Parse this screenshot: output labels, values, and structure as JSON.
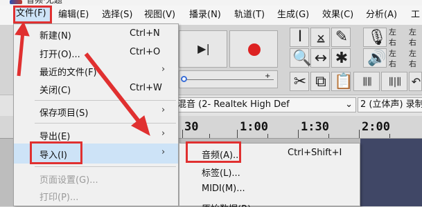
{
  "window": {
    "title": "音频·无题"
  },
  "menubar": {
    "items": [
      {
        "label": "文件(F)"
      },
      {
        "label": "编辑(E)"
      },
      {
        "label": "选择(S)"
      },
      {
        "label": "视图(V)"
      },
      {
        "label": "播录(N)"
      },
      {
        "label": "轨道(T)"
      },
      {
        "label": "生成(G)"
      },
      {
        "label": "效果(C)"
      },
      {
        "label": "分析(A)"
      },
      {
        "label": "工"
      }
    ]
  },
  "file_menu": {
    "items": [
      {
        "label": "新建(N)",
        "shortcut": "Ctrl+N"
      },
      {
        "label": "打开(O)...",
        "shortcut": "Ctrl+O"
      },
      {
        "label": "最近的文件(F)",
        "arrow": "›"
      },
      {
        "label": "关闭(C)",
        "shortcut": "Ctrl+W"
      },
      {
        "label": "保存项目(S)",
        "arrow": "›"
      },
      {
        "label": "导出(E)",
        "arrow": "›"
      },
      {
        "label": "导入(I)",
        "arrow": "›"
      },
      {
        "label": "页面设置(G)..."
      },
      {
        "label": "打印(P)..."
      }
    ]
  },
  "import_submenu": {
    "items": [
      {
        "label": "音频(A)...",
        "shortcut": "Ctrl+Shift+I"
      },
      {
        "label": "标签(L)..."
      },
      {
        "label": "MIDI(M)..."
      },
      {
        "label": "原始数据(R)..."
      }
    ]
  },
  "toolbar": {
    "meter_labels": [
      "左",
      "右",
      "左",
      "右",
      "左",
      "右",
      "左",
      "右"
    ]
  },
  "device_row": {
    "input_device": "混音 (2- Realtek High Def",
    "channels": "2 (立体声) 录制"
  },
  "timeline": {
    "labels": [
      "30",
      "1:00",
      "1:30",
      "2:00"
    ]
  },
  "colors": {
    "annotation": "#e03030",
    "menu_highlight": "#cde3f7",
    "track_blue": "#404766"
  }
}
